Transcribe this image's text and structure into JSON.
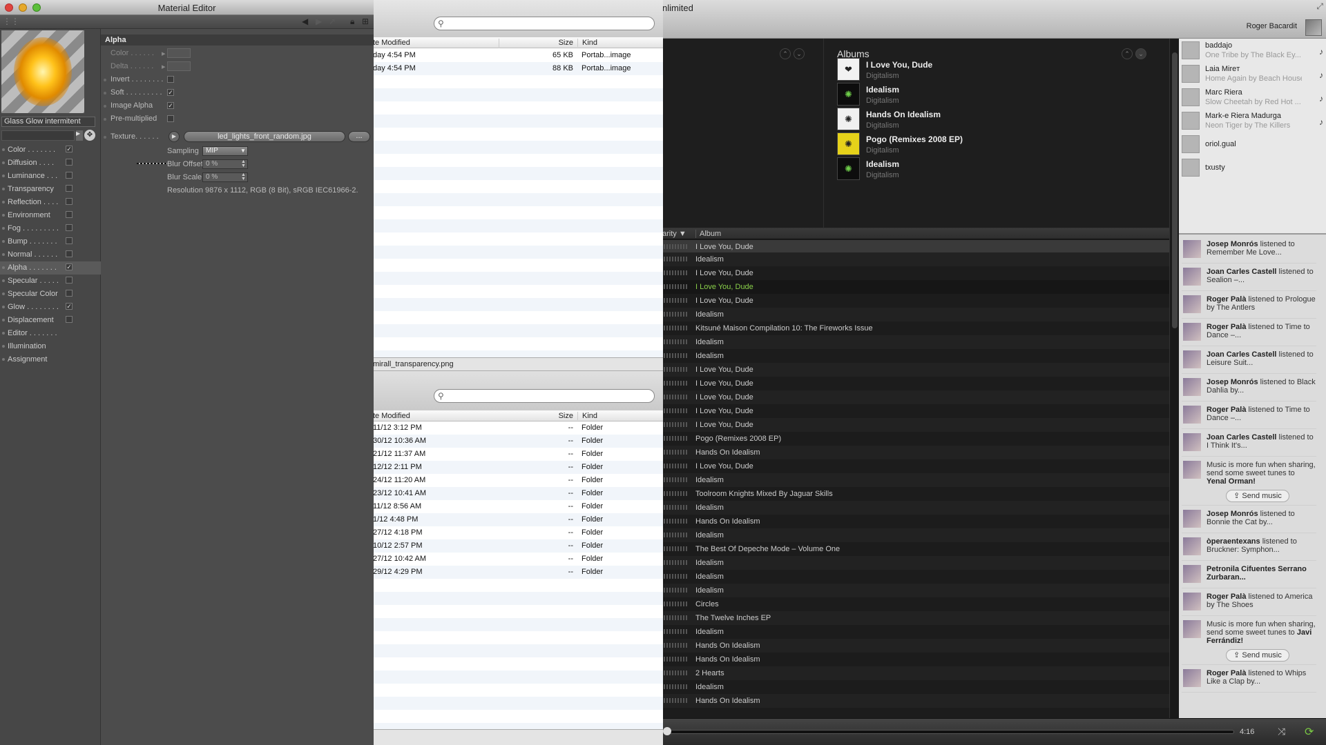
{
  "material_editor": {
    "title": "Material Editor",
    "material_name": "Glass Glow intermitent",
    "section_title": "Alpha",
    "channels": [
      {
        "label": "Color . . . . . . .",
        "checked": true
      },
      {
        "label": "Diffusion . . . .",
        "checked": false
      },
      {
        "label": "Luminance . . .",
        "checked": false
      },
      {
        "label": "Transparency",
        "checked": false
      },
      {
        "label": "Reflection . . . .",
        "checked": false
      },
      {
        "label": "Environment",
        "checked": false
      },
      {
        "label": "Fog . . . . . . . . .",
        "checked": false
      },
      {
        "label": "Bump . . . . . . .",
        "checked": false
      },
      {
        "label": "Normal . . . . . .",
        "checked": false
      },
      {
        "label": "Alpha . . . . . . .",
        "checked": true,
        "active": true
      },
      {
        "label": "Specular . . . . .",
        "checked": false
      },
      {
        "label": "Specular Color",
        "checked": false
      },
      {
        "label": "Glow . . . . . . . .",
        "checked": true
      },
      {
        "label": "Displacement",
        "checked": false
      },
      {
        "label": "Editor . . . . . . .",
        "checked": null
      },
      {
        "label": "Illumination",
        "checked": null
      },
      {
        "label": "Assignment",
        "checked": null
      }
    ],
    "props": {
      "color_label": "Color . . . . . .",
      "delta_label": "Delta . . . . . .",
      "invert_label": "Invert . . . . . . . .",
      "soft_label": "Soft . . . . . . . . .",
      "image_alpha_label": "Image Alpha",
      "premult_label": "Pre-multiplied",
      "texture_label": "Texture. . . . . .",
      "texture_file": "led_lights_front_random.jpg",
      "more_label": "...",
      "sampling_label": "Sampling",
      "sampling_value": "MIP",
      "blur_offset_label": "Blur Offset",
      "blur_offset_value": "0 %",
      "blur_scale_label": "Blur Scale",
      "blur_scale_value": "0 %",
      "resolution": "Resolution 9876 x 1112, RGB (8 Bit), sRGB IEC61966-2."
    }
  },
  "finder": {
    "top": {
      "cols": {
        "date": "te Modified",
        "size": "Size",
        "kind": "Kind"
      },
      "rows": [
        {
          "date": "day 4:54 PM",
          "size": "65 KB",
          "kind": "Portab...image"
        },
        {
          "date": "day 4:54 PM",
          "size": "88 KB",
          "kind": "Portab...image"
        }
      ]
    },
    "path_item": "mirall_transparency.png",
    "bottom": {
      "cols": {
        "date": "te Modified",
        "size": "Size",
        "kind": "Kind"
      },
      "rows": [
        {
          "date": "11/12 3:12 PM",
          "size": "--",
          "kind": "Folder"
        },
        {
          "date": "30/12 10:36 AM",
          "size": "--",
          "kind": "Folder"
        },
        {
          "date": "21/12 11:37 AM",
          "size": "--",
          "kind": "Folder"
        },
        {
          "date": "12/12 2:11 PM",
          "size": "--",
          "kind": "Folder"
        },
        {
          "date": "24/12 11:20 AM",
          "size": "--",
          "kind": "Folder"
        },
        {
          "date": "23/12 10:41 AM",
          "size": "--",
          "kind": "Folder"
        },
        {
          "date": "11/12 8:56 AM",
          "size": "--",
          "kind": "Folder"
        },
        {
          "date": "1/12 4:48 PM",
          "size": "--",
          "kind": "Folder"
        },
        {
          "date": "27/12 4:18 PM",
          "size": "--",
          "kind": "Folder"
        },
        {
          "date": "10/12 2:57 PM",
          "size": "--",
          "kind": "Folder"
        },
        {
          "date": "27/12 10:42 AM",
          "size": "--",
          "kind": "Folder"
        },
        {
          "date": "29/12 4:29 PM",
          "size": "--",
          "kind": "Folder"
        }
      ]
    }
  },
  "spotify": {
    "title": "nlimited",
    "user": "Roger Bacardit",
    "albums_heading": "Albums",
    "albums": [
      {
        "name": "I Love You, Dude",
        "artist": "Digitalism",
        "cover": "#f2f2f2",
        "mark": "❤"
      },
      {
        "name": "Idealism",
        "artist": "Digitalism",
        "cover": "#0d0d0d",
        "mark": "✺"
      },
      {
        "name": "Hands On Idealism",
        "artist": "Digitalism",
        "cover": "#f0f0f0",
        "mark": "✺"
      },
      {
        "name": "Pogo (Remixes 2008 EP)",
        "artist": "Digitalism",
        "cover": "#e6d21a",
        "mark": "✺"
      },
      {
        "name": "Idealism",
        "artist": "Digitalism",
        "cover": "#0d0d0d",
        "mark": "✺"
      }
    ],
    "col_popularity": "arity ▼",
    "col_album": "Album",
    "tracks": [
      {
        "album": "I Love You, Dude",
        "state": "sel"
      },
      {
        "album": "Idealism"
      },
      {
        "album": "I Love You, Dude"
      },
      {
        "album": "I Love You, Dude",
        "state": "play"
      },
      {
        "album": "I Love You, Dude"
      },
      {
        "album": "Idealism"
      },
      {
        "album": "Kitsuné Maison Compilation 10: The Fireworks Issue"
      },
      {
        "album": "Idealism"
      },
      {
        "album": "Idealism"
      },
      {
        "album": "I Love You, Dude"
      },
      {
        "album": "I Love You, Dude"
      },
      {
        "album": "I Love You, Dude"
      },
      {
        "album": "I Love You, Dude"
      },
      {
        "album": "I Love You, Dude"
      },
      {
        "album": "Pogo (Remixes 2008 EP)"
      },
      {
        "album": "Hands On Idealism"
      },
      {
        "album": "I Love You, Dude"
      },
      {
        "album": "Idealism"
      },
      {
        "album": "Toolroom Knights Mixed By Jaguar Skills"
      },
      {
        "album": "Idealism"
      },
      {
        "album": "Hands On Idealism"
      },
      {
        "album": "Idealism"
      },
      {
        "album": "The Best Of Depeche Mode – Volume One"
      },
      {
        "album": "Idealism"
      },
      {
        "album": "Idealism"
      },
      {
        "album": "Idealism"
      },
      {
        "album": "Circles"
      },
      {
        "album": "The Twelve Inches EP"
      },
      {
        "album": "Idealism"
      },
      {
        "album": "Hands On Idealism"
      },
      {
        "album": "Hands On Idealism"
      },
      {
        "album": "2 Hearts"
      },
      {
        "album": "Idealism"
      },
      {
        "album": "Hands On Idealism"
      }
    ],
    "friends": [
      {
        "name": "baddajo",
        "status": "One Tribe by The Black Ey...",
        "note": true
      },
      {
        "name": "Laia Mireт",
        "status": "Home Again by Beach House",
        "note": true
      },
      {
        "name": "Marc Riera",
        "status": "Slow Cheetah by Red Hot ...",
        "note": true
      },
      {
        "name": "Mark-e Riera Madurga",
        "status": "Neon Tiger by The Killers",
        "note": true
      },
      {
        "name": "oriol.gual",
        "status": "",
        "note": false
      },
      {
        "name": "txusty",
        "status": "",
        "note": false
      }
    ],
    "feed": [
      {
        "who": "Josep Monrós",
        "text": " listened to Remember Me Love..."
      },
      {
        "who": "Joan Carles Castell",
        "text": " listened to Sealion –..."
      },
      {
        "who": "Roger Palà",
        "text": " listened to Prologue by The Antlers"
      },
      {
        "who": "Roger Palà",
        "text": " listened to Time to Dance –..."
      },
      {
        "who": "Joan Carles Castell",
        "text": " listened to Leisure Suit..."
      },
      {
        "who": "Josep Monrós",
        "text": " listened to Black Dahlia by..."
      },
      {
        "who": "Roger Palà",
        "text": " listened to Time to Dance –..."
      },
      {
        "who": "Joan Carles Castell",
        "text": " listened to I Think It's..."
      },
      {
        "who": "",
        "text": "Music is more fun when sharing, send some sweet tunes to ",
        "target": "Yenal Orman!",
        "send": "Send music"
      },
      {
        "who": "Josep Monrós",
        "text": " listened to Bonnie the Cat by..."
      },
      {
        "who": "òperaentexans",
        "text": " listened to Bruckner: Symphon..."
      },
      {
        "who": "Petronila Cifuentes Serrano Zurbaran...",
        "text": ""
      },
      {
        "who": "Roger Palà",
        "text": " listened to America by The Shoes"
      },
      {
        "who": "",
        "text": "Music is more fun when sharing, send some sweet tunes to ",
        "target": "Javi Ferrándiz!",
        "send": "Send music"
      },
      {
        "who": "Roger Palà",
        "text": " listened to Whips Like a Clap by..."
      }
    ],
    "time": "4:16"
  }
}
